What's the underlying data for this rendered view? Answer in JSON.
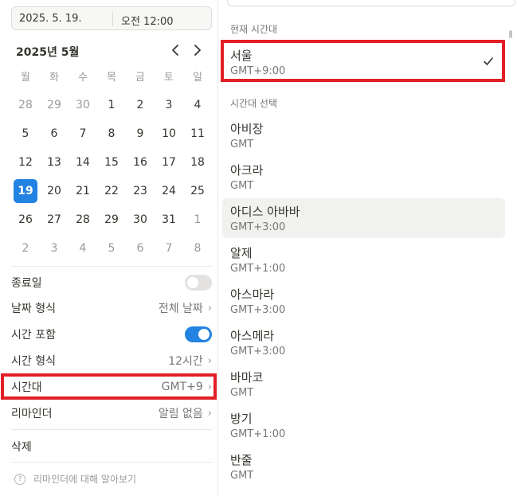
{
  "datetime": {
    "date": "2025. 5. 19.",
    "time": "오전 12:00"
  },
  "calendar": {
    "month_label": "2025년 5월",
    "weekdays": [
      "월",
      "화",
      "수",
      "목",
      "금",
      "토",
      "일"
    ],
    "weeks": [
      [
        "28",
        "29",
        "30",
        "1",
        "2",
        "3",
        "4"
      ],
      [
        "5",
        "6",
        "7",
        "8",
        "9",
        "10",
        "11"
      ],
      [
        "12",
        "13",
        "14",
        "15",
        "16",
        "17",
        "18"
      ],
      [
        "19",
        "20",
        "21",
        "22",
        "23",
        "24",
        "25"
      ],
      [
        "26",
        "27",
        "28",
        "29",
        "30",
        "31",
        "1"
      ],
      [
        "2",
        "3",
        "4",
        "5",
        "6",
        "7",
        "8"
      ]
    ],
    "selected_day": "19",
    "accent_color": "#2383e2"
  },
  "options": {
    "end_date_label": "종료일",
    "end_date_enabled": false,
    "date_format_label": "날짜 형식",
    "date_format_value": "전체 날짜",
    "include_time_label": "시간 포함",
    "include_time_enabled": true,
    "time_format_label": "시간 형식",
    "time_format_value": "12시간",
    "timezone_label": "시간대",
    "timezone_value": "GMT+9",
    "reminder_label": "리마인더",
    "reminder_value": "알림 없음",
    "delete_label": "삭제",
    "help_text": "리마인더에 대해 알아보기"
  },
  "timezone_panel": {
    "current_label": "현재 시간대",
    "current": {
      "name": "서울",
      "offset": "GMT+9:00"
    },
    "select_label": "시간대 선택",
    "items": [
      {
        "name": "아비장",
        "offset": "GMT"
      },
      {
        "name": "아크라",
        "offset": "GMT"
      },
      {
        "name": "아디스 아바바",
        "offset": "GMT+3:00"
      },
      {
        "name": "알제",
        "offset": "GMT+1:00"
      },
      {
        "name": "아스마라",
        "offset": "GMT+3:00"
      },
      {
        "name": "아스메라",
        "offset": "GMT+3:00"
      },
      {
        "name": "바마코",
        "offset": "GMT"
      },
      {
        "name": "방기",
        "offset": "GMT+1:00"
      },
      {
        "name": "반줄",
        "offset": "GMT"
      }
    ]
  },
  "highlight_color": "#e21f26"
}
